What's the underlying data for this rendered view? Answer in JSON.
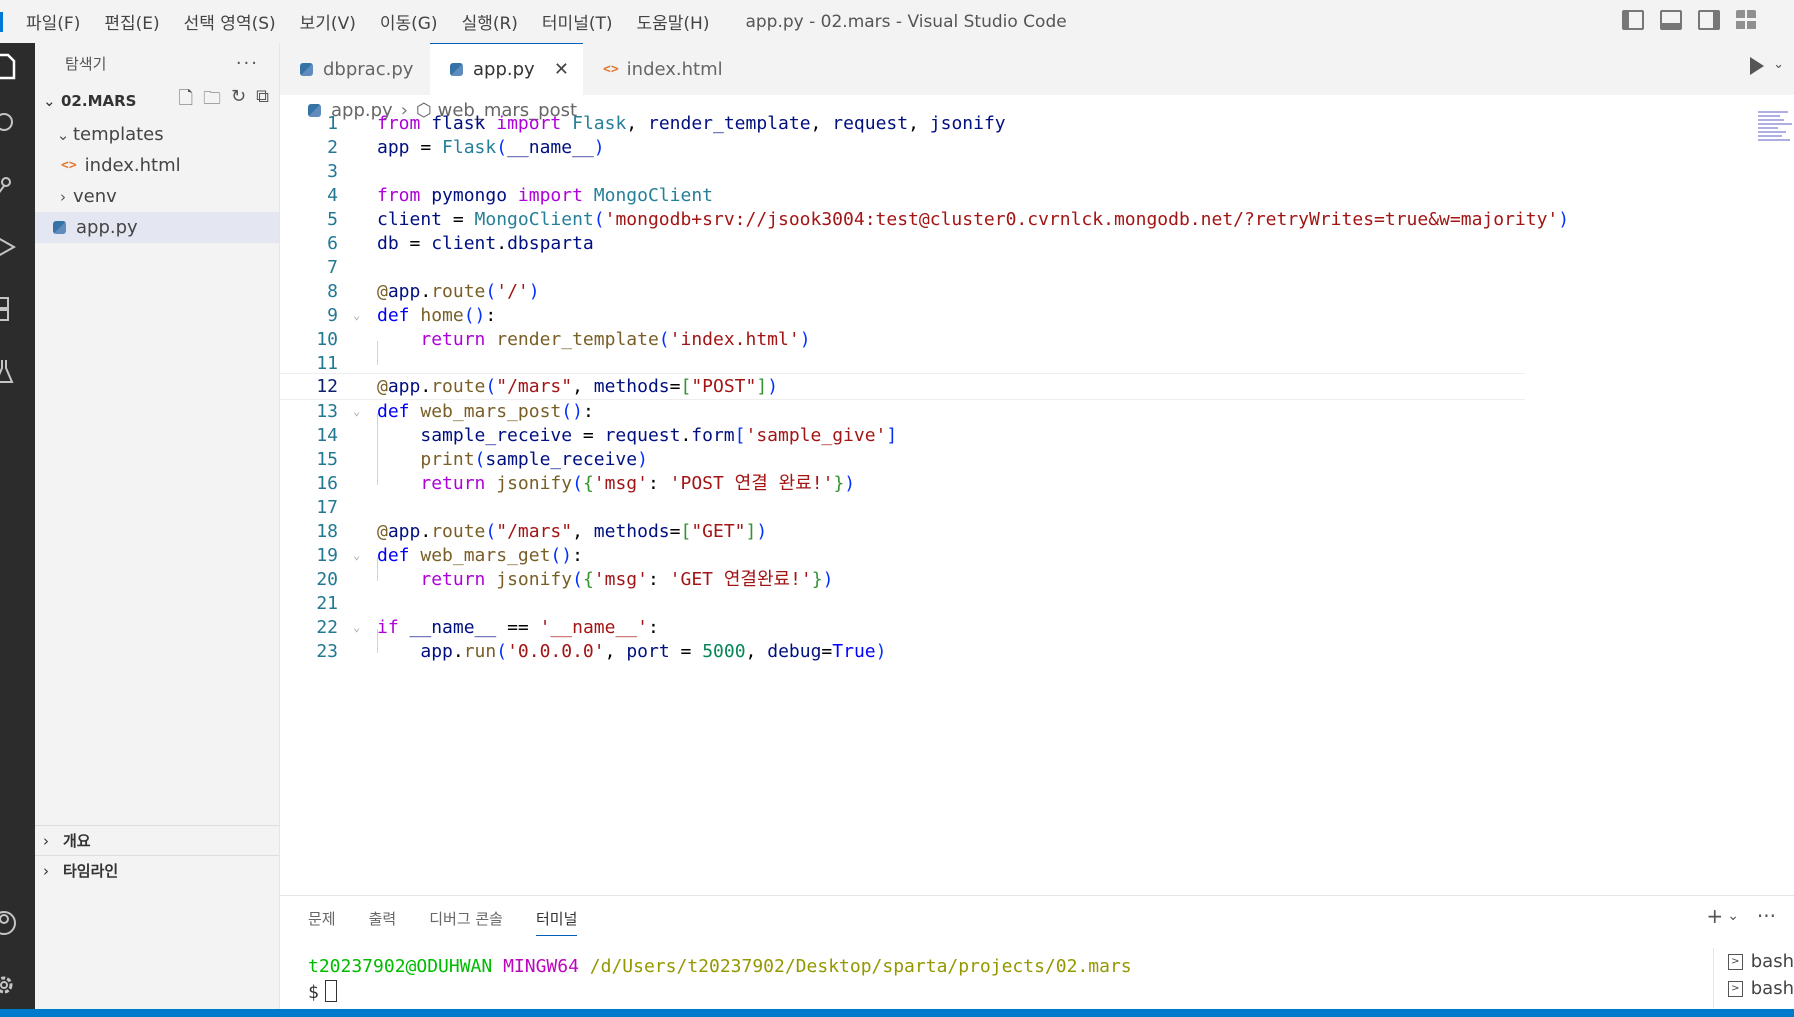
{
  "menu": [
    "파일(F)",
    "편집(E)",
    "선택 영역(S)",
    "보기(V)",
    "이동(G)",
    "실행(R)",
    "터미널(T)",
    "도움말(H)"
  ],
  "window_title": "app.py - 02.mars - Visual Studio Code",
  "sidebar": {
    "header": "탐색기",
    "more": "···",
    "root": "02.MARS",
    "items": [
      {
        "label": "templates"
      },
      {
        "label": "index.html"
      },
      {
        "label": "venv"
      },
      {
        "label": "app.py"
      }
    ],
    "outline": "개요",
    "timeline": "타임라인"
  },
  "tabs": [
    {
      "label": "dbprac.py"
    },
    {
      "label": "app.py",
      "close": "✕"
    },
    {
      "label": "index.html"
    }
  ],
  "breadcrumb": {
    "file": "app.py",
    "symbol": "web_mars_post"
  },
  "code": {
    "line_numbers": [
      "1",
      "2",
      "3",
      "4",
      "5",
      "6",
      "7",
      "8",
      "9",
      "10",
      "11",
      "12",
      "13",
      "14",
      "15",
      "16",
      "17",
      "18",
      "19",
      "20",
      "21",
      "22",
      "23"
    ],
    "t": {
      "from": "from",
      "flask": "flask",
      "import": "import",
      "Flask": "Flask",
      "render_template": "render_template",
      "request": "request",
      "jsonify": "jsonify",
      "app": "app",
      "name_dunder": "__name__",
      "pymongo": "pymongo",
      "MongoClient": "MongoClient",
      "client": "client",
      "mongo_uri": "'mongodb+srv://jsook3004:test@cluster0.cvrnlck.mongodb.net/?retryWrites=true&w=majority'",
      "db": "db",
      "dbsparta": "dbsparta",
      "route": "route",
      "slash": "'/'",
      "def": "def",
      "home": "home",
      "return": "return",
      "index_html": "'index.html'",
      "mars_path": "\"/mars\"",
      "methods": "methods",
      "POST": "\"POST\"",
      "web_mars_post": "web_mars_post",
      "sample_receive": "sample_receive",
      "form": "form",
      "sample_give": "'sample_give'",
      "print": "print",
      "msg": "'msg'",
      "post_msg": "'POST 연결 완료!'",
      "GET": "\"GET\"",
      "web_mars_get": "web_mars_get",
      "get_msg": "'GET 연결완료!'",
      "if": "if",
      "name_str": "'__name__'",
      "run": "run",
      "ip": "'0.0.0.0'",
      "port": "port",
      "port_num": "5000",
      "debug": "debug",
      "True": "True"
    }
  },
  "panel": {
    "tabs": [
      "문제",
      "출력",
      "디버그 콘솔",
      "터미널"
    ],
    "active_tab": "터미널",
    "terminal": {
      "user": "t20237902@ODUHWAN",
      "shell": "MINGW64",
      "path": "/d/Users/t20237902/Desktop/sparta/projects/02.mars",
      "prompt": "$"
    },
    "terminal_list": [
      "bash",
      "bash"
    ],
    "add": "+",
    "dropdown": "⌄",
    "more": "···"
  },
  "colors": {
    "accent": "#005fb8",
    "status_bar": "#007acc",
    "keyword": "#af00db",
    "string": "#a31515",
    "function": "#795e26"
  }
}
